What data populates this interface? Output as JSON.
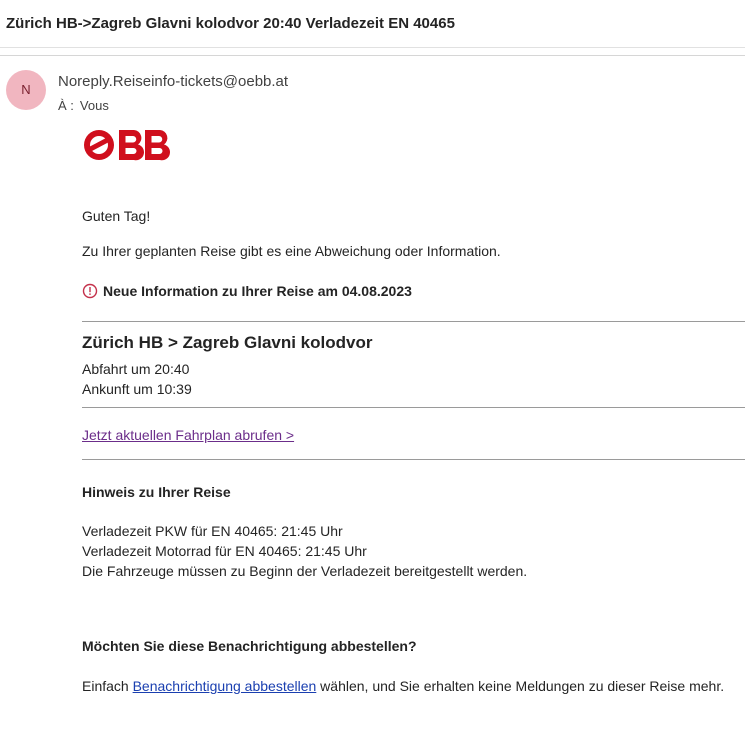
{
  "email": {
    "subject": "Zürich HB->Zagreb Glavni kolodvor 20:40 Verladezeit EN 40465",
    "avatar_initial": "N",
    "sender": "Noreply.Reiseinfo-tickets@oebb.at",
    "to_label": "À :",
    "to_value": "Vous"
  },
  "logo": {
    "text": "ÖBB",
    "color": "#d00f1d"
  },
  "body": {
    "greeting": "Guten Tag!",
    "intro": "Zu Ihrer geplanten Reise gibt es eine Abweichung oder Information.",
    "info_heading": "Neue Information zu Ihrer Reise am 04.08.2023",
    "route": "Zürich HB > Zagreb Glavni kolodvor",
    "departure": "Abfahrt um 20:40",
    "arrival": "Ankunft um 10:39",
    "fahrplan_link": "Jetzt aktuellen Fahrplan abrufen >",
    "hinweis_heading": "Hinweis zu Ihrer Reise",
    "hinweis_lines": [
      "Verladezeit PKW für EN 40465: 21:45 Uhr",
      "Verladezeit Motorrad für EN 40465: 21:45 Uhr",
      "Die Fahrzeuge müssen zu Beginn der Verladezeit bereitgestellt werden."
    ],
    "unsubscribe_heading": "Möchten Sie diese Benachrichtigung abbestellen?",
    "unsubscribe_prefix": "Einfach ",
    "unsubscribe_link": "Benachrichtigung abbestellen",
    "unsubscribe_suffix": " wählen, und Sie erhalten keine Meldungen zu dieser Reise mehr."
  },
  "colors": {
    "accent_red": "#d00f1d",
    "info_icon": "#c4314b",
    "link_visited": "#6b2d8a",
    "link": "#1a3fb0"
  }
}
